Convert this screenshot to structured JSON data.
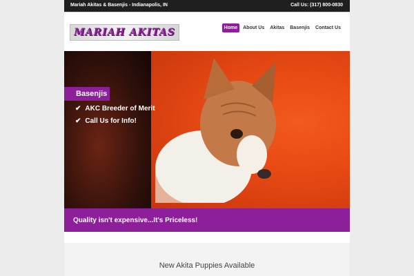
{
  "topbar": {
    "site_name": "Mariah Akitas & Basenjis - Indianapolis, IN",
    "call_us": "Call Us: (317) 800-0830"
  },
  "header": {
    "logo_text": "MARIAH AKITAS",
    "nav": [
      {
        "label": "Home",
        "active": true
      },
      {
        "label": "About Us"
      },
      {
        "label": "Akitas"
      },
      {
        "label": "Basenjis"
      },
      {
        "label": "Contact Us"
      }
    ]
  },
  "hero": {
    "tag": "Basenjis",
    "bullets": [
      "AKC Breeder of Merit",
      "Call Us for Info!"
    ],
    "check_icon": "check-icon"
  },
  "quote": "Quality isn't expensive...It's Priceless!",
  "section": {
    "heading": "New Akita Puppies Available"
  },
  "colors": {
    "accent": "#8e1f9b",
    "topbar": "#1f1f1f"
  }
}
